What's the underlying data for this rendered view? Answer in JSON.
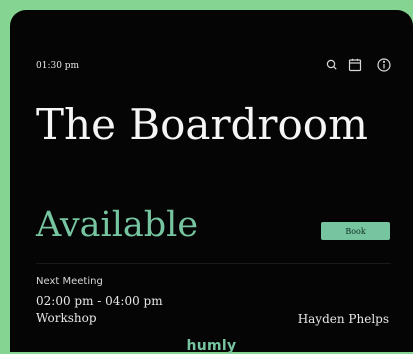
{
  "clock": {
    "time": "01:30 pm"
  },
  "toolbar": {
    "icons": [
      "search-icon",
      "calendar-icon",
      "info-icon"
    ]
  },
  "room": {
    "name": "The Boardroom"
  },
  "status": {
    "label": "Available",
    "color": "#76c5a0"
  },
  "actions": {
    "book_label": "Book"
  },
  "next_meeting": {
    "heading": "Next Meeting",
    "time_range": "02:00 pm - 04:00 pm",
    "subject": "Workshop",
    "organizer": "Hayden Phelps"
  },
  "brand": {
    "name": "humly"
  }
}
